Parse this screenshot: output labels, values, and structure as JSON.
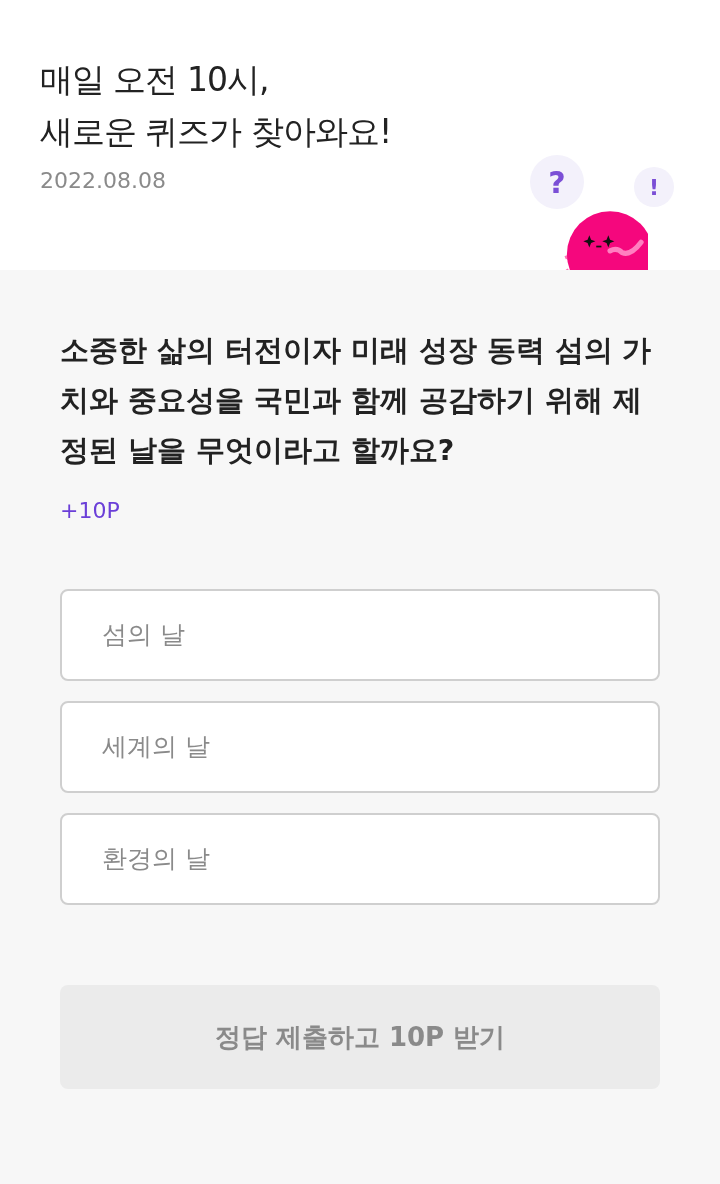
{
  "header": {
    "title_lines": [
      "매일 오전 10시,",
      "새로운 퀴즈가 찾아와요!"
    ],
    "date": "2022.08.08",
    "mascot_bubbles": [
      "?",
      "!"
    ]
  },
  "quiz": {
    "question": "소중한 삶의 터전이자 미래 성장 동력 섬의 가치와 중요성을 국민과 함께 공감하기 위해 제정된 날을 무엇이라고 할까요?",
    "points": "+10P",
    "options": [
      {
        "label": "섬의 날",
        "selected": false
      },
      {
        "label": "세계의 날",
        "selected": false
      },
      {
        "label": "환경의 날",
        "selected": false
      }
    ],
    "submit": {
      "label": "정답 제출하고 10P 받기",
      "disabled": true
    }
  }
}
